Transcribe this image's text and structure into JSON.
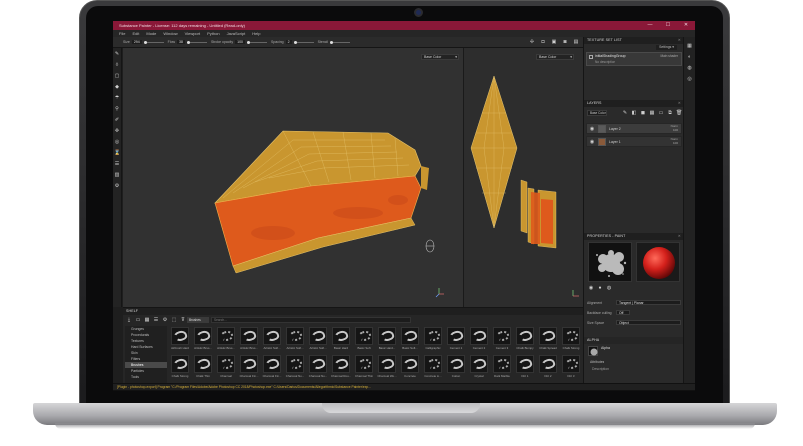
{
  "window": {
    "title": "Substance Painter - License: 112 days remaining - Untitled (Read-only)",
    "controls": [
      "—",
      "☐",
      "✕"
    ]
  },
  "menu": [
    "File",
    "Edit",
    "Mode",
    "Window",
    "Viewport",
    "Python",
    "JavaScript",
    "Help"
  ],
  "tool_properties": [
    {
      "label": "Size",
      "value": "294"
    },
    {
      "label": "Flow",
      "value": "38"
    },
    {
      "label": "Stroke opacity",
      "value": "100"
    },
    {
      "label": "Spacing",
      "value": "2"
    },
    {
      "label": "Stencil",
      "value": ""
    }
  ],
  "viewports": {
    "left_channel": "Base Color",
    "right_channel": "Base Color"
  },
  "texture_set_list": {
    "title": "TEXTURE SET LIST",
    "settings_label": "Settings ▾",
    "item_name": "initialShadingGroup",
    "item_shader": "Main shader",
    "item_description": "No description"
  },
  "layers": {
    "title": "LAYERS",
    "channel": "Base Color",
    "rows": [
      {
        "name": "Layer 2",
        "mode": "Norm",
        "opacity": "100"
      },
      {
        "name": "Layer 1",
        "mode": "Norm",
        "opacity": "100"
      }
    ]
  },
  "properties": {
    "title": "PROPERTIES - PAINT",
    "rows": [
      {
        "label": "Alignment",
        "value": "Tangent | Planar"
      },
      {
        "label": "Backface culling",
        "value": "Off"
      },
      {
        "label": "Size Space",
        "value": "Object"
      }
    ],
    "alpha_title": "ALPHA",
    "alpha_name": "Alpha",
    "attributes_label": "Attributes",
    "description_label": "Description"
  },
  "shelf": {
    "title": "SHELF",
    "search_placeholder": "Search...",
    "filter_tag": "Brushes",
    "categories": [
      "Grunges",
      "Procedurals",
      "Textures",
      "Hard Surfaces",
      "Skin",
      "Filters",
      "Brushes",
      "Particles",
      "Tools"
    ],
    "selected_category": "Brushes",
    "brush_row1": [
      "Airbrush Hard",
      "Artistic Brus...",
      "Artistic Brus...",
      "Artistic Brus...",
      "Artistic Soft...",
      "Artistic Soft...",
      "Artistic Soft...",
      "Basic Hard",
      "Basic Soft",
      "Basic Hard...",
      "Basic Soft...",
      "Calligraphic",
      "Cement 1",
      "Cement 2",
      "Cement 3",
      "Chalk Bumpy",
      "Chalk Spread",
      "Chalk Strong"
    ],
    "brush_row2": [
      "Chalk Strong",
      "Chalk Thin",
      "Charcoal",
      "Charcoal Fin...",
      "Charcoal Fin...",
      "Charcoal No...",
      "Charcoal No...",
      "Charcoal Rou...",
      "Charcoal Thin",
      "Charcoal Wo...",
      "Concrete",
      "Concrete Li...",
      "Cotton",
      "Crystal",
      "Dark Marble",
      "Dirt 1",
      "Dirt 2",
      "Dirt 3"
    ]
  },
  "status_line": "[Plugin - photoshop-export] Program \"C:/Program Files/Adobe/Adobe Photoshop CC 2018/Photoshop.exe\" C:/Users/Darius/Documents/Allegorithmic/Substance Painter/exp..."
}
